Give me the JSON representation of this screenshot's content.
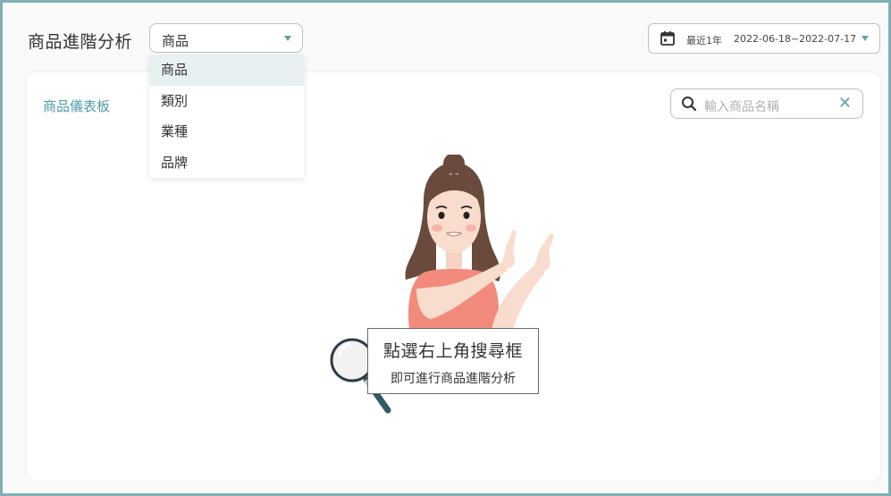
{
  "header": {
    "title": "商品進階分析",
    "dimension_select": {
      "value": "商品",
      "options": [
        "商品",
        "類別",
        "業種",
        "品牌"
      ]
    },
    "date_range": {
      "label": "最近1年",
      "dates": "2022-06-18~2022-07-17"
    }
  },
  "card": {
    "title": "商品儀表板",
    "search": {
      "placeholder": "輸入商品名稱"
    },
    "empty_state": {
      "line1": "點選右上角搜尋框",
      "line2": "即可進行商品進階分析"
    }
  },
  "colors": {
    "accent": "#5fa2a8",
    "border": "#7fb0b6",
    "selected_option_bg": "#e8f1f2",
    "shirt": "#f28b7b",
    "hair": "#6a4a3c"
  },
  "icons": [
    "calendar-icon",
    "search-icon",
    "clear-icon",
    "caret-down-icon",
    "magnifier-illustration"
  ]
}
